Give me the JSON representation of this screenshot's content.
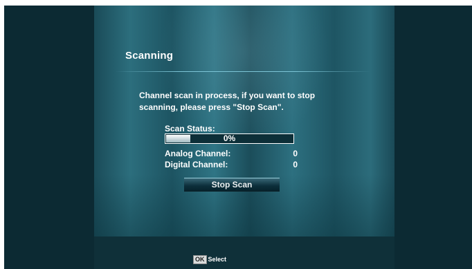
{
  "dialog": {
    "title": "Scanning",
    "message": "Channel scan in process, if you want to stop scanning, please press \"Stop Scan\"."
  },
  "scan_status": {
    "label": "Scan Status:",
    "progress_text": "0%",
    "progress_fraction": 0.2
  },
  "channels": {
    "analog_label": "Analog Channel:",
    "analog_count": "0",
    "digital_label": "Digital Channel:",
    "digital_count": "0"
  },
  "buttons": {
    "stop_scan": "Stop Scan"
  },
  "footer": {
    "key": "OK",
    "action": "Select"
  }
}
